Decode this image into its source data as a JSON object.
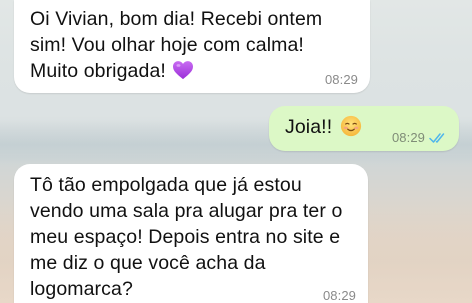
{
  "chat": {
    "messages": [
      {
        "direction": "incoming",
        "text": "Oi Vivian, bom dia! Recebi ontem\nsim! Vou olhar hoje com calma!\nMuito obrigada!",
        "emoji": "purple-heart",
        "time": "08:29"
      },
      {
        "direction": "outgoing",
        "text": "Joia!!",
        "emoji": "smiling-face",
        "time": "08:29",
        "status": "read",
        "status_color": "#4fb6ec"
      },
      {
        "direction": "incoming",
        "text": "Tô tão empolgada que já estou\nvendo uma sala pra alugar pra ter o\nmeu espaço! Depois entra no site e\nme diz o que você acha da\nlogomarca?",
        "time": "08:29"
      }
    ]
  },
  "colors": {
    "incoming_bubble": "#ffffff",
    "outgoing_bubble": "#dcf8c6",
    "timestamp": "#8a8a8a"
  }
}
